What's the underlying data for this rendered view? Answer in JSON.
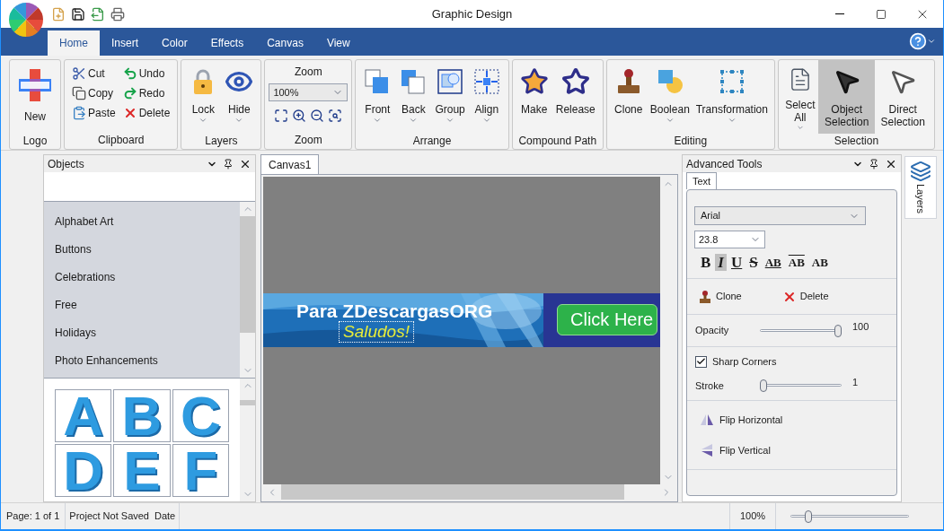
{
  "window": {
    "title": "Graphic Design"
  },
  "ribbon": {
    "tabs": [
      {
        "label": "Home",
        "selected": true
      },
      {
        "label": "Insert",
        "selected": false
      },
      {
        "label": "Color",
        "selected": false
      },
      {
        "label": "Effects",
        "selected": false
      },
      {
        "label": "Canvas",
        "selected": false
      },
      {
        "label": "View",
        "selected": false
      }
    ],
    "groups": [
      {
        "label": "Logo",
        "items": [
          {
            "kind": "large",
            "label": "New",
            "dropdown": false,
            "selected": false
          }
        ]
      },
      {
        "label": "Clipboard",
        "items": [
          {
            "kind": "small",
            "label": "Cut"
          },
          {
            "kind": "small",
            "label": "Copy"
          },
          {
            "kind": "small",
            "label": "Paste"
          },
          {
            "kind": "small",
            "label": "Undo"
          },
          {
            "kind": "small",
            "label": "Redo"
          },
          {
            "kind": "small",
            "label": "Delete"
          }
        ]
      },
      {
        "label": "Layers",
        "items": [
          {
            "kind": "large",
            "label": "Lock",
            "dropdown": true,
            "selected": false
          },
          {
            "kind": "large",
            "label": "Hide",
            "dropdown": true,
            "selected": false
          }
        ]
      },
      {
        "label": "Zoom",
        "items": [
          {
            "kind": "caption",
            "label": "Zoom"
          },
          {
            "kind": "combo",
            "value": "100%"
          },
          {
            "kind": "icons"
          }
        ]
      },
      {
        "label": "Arrange",
        "items": [
          {
            "kind": "large",
            "label": "Front",
            "dropdown": true,
            "selected": false
          },
          {
            "kind": "large",
            "label": "Back",
            "dropdown": true,
            "selected": false
          },
          {
            "kind": "large",
            "label": "Group",
            "dropdown": true,
            "selected": false
          },
          {
            "kind": "large",
            "label": "Align",
            "dropdown": true,
            "selected": false
          }
        ]
      },
      {
        "label": "Compound Path",
        "items": [
          {
            "kind": "large",
            "label": "Make",
            "dropdown": false,
            "selected": false
          },
          {
            "kind": "large",
            "label": "Release",
            "dropdown": false,
            "selected": false
          }
        ]
      },
      {
        "label": "Editing",
        "items": [
          {
            "kind": "large",
            "label": "Clone",
            "dropdown": false,
            "selected": false
          },
          {
            "kind": "large",
            "label": "Boolean",
            "dropdown": true,
            "selected": false
          },
          {
            "kind": "large",
            "label": "Transformation",
            "dropdown": true,
            "selected": false
          }
        ]
      },
      {
        "label": "Selection",
        "items": [
          {
            "kind": "large",
            "label": "Select All",
            "dropdown": true,
            "selected": false
          },
          {
            "kind": "large",
            "label": "Object Selection",
            "dropdown": false,
            "selected": true
          },
          {
            "kind": "large",
            "label": "Direct Selection",
            "dropdown": false,
            "selected": false
          }
        ]
      }
    ]
  },
  "objects_panel": {
    "title": "Objects",
    "categories": [
      {
        "label": "Alphabet Art"
      },
      {
        "label": "Buttons"
      },
      {
        "label": "Celebrations"
      },
      {
        "label": "Free"
      },
      {
        "label": "Holidays"
      },
      {
        "label": "Photo Enhancements"
      }
    ],
    "thumbnails": [
      "A",
      "B",
      "C",
      "D",
      "E",
      "F"
    ]
  },
  "canvas": {
    "tab": "Canvas1",
    "banner": {
      "headline": "Para ZDescargasORG",
      "subtitle": "Saludos!",
      "button": "Click Here"
    }
  },
  "advanced_tools": {
    "title": "Advanced Tools",
    "tab": "Text",
    "font": "Arial",
    "size": "23.8",
    "styles": [
      {
        "label": "B",
        "kind": "bold",
        "selected": false
      },
      {
        "label": "I",
        "kind": "italic",
        "selected": true
      },
      {
        "label": "U",
        "kind": "underline",
        "selected": false
      },
      {
        "label": "S",
        "kind": "strike",
        "selected": false
      },
      {
        "label": "AB",
        "kind": "under",
        "selected": false
      },
      {
        "label": "AB",
        "kind": "over",
        "selected": false
      },
      {
        "label": "AB",
        "kind": "plain",
        "selected": false
      }
    ],
    "actions": [
      "Clone",
      "Delete"
    ],
    "opacity": {
      "label": "Opacity",
      "level": 1,
      "reading": "100"
    },
    "sharp_corners": {
      "label": "Sharp Corners",
      "checked": true
    },
    "stroke": {
      "label": "Stroke",
      "level": 0,
      "reading": "1"
    },
    "flips": [
      "Flip Horizontal",
      "Flip Vertical"
    ]
  },
  "side_tab": {
    "label": "Layers"
  },
  "status_bar": {
    "page": "Page: 1 of 1",
    "project": "Project Not Saved",
    "date": "Date",
    "zoom": "100%",
    "zoom_slider": {
      "level": 0.15
    }
  }
}
